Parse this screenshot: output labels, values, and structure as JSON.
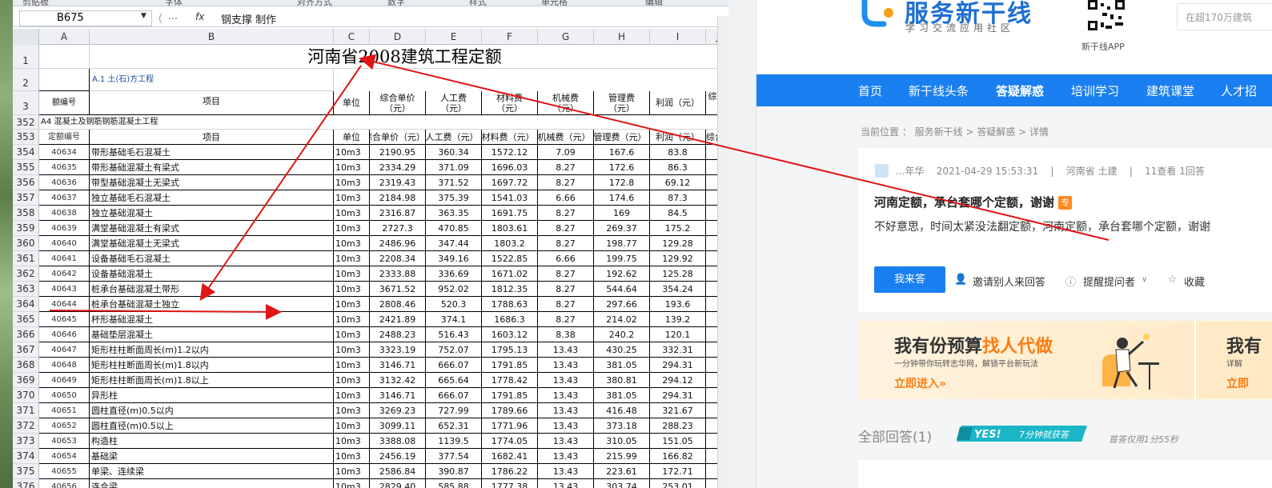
{
  "excel": {
    "ribbon_groups": [
      "剪贴板",
      "字体",
      "对齐方式",
      "数字",
      "样式",
      "单元格",
      "编辑"
    ],
    "name_box": "B675",
    "fx_symbol": "fx",
    "formula_content": "钢支撑 制作",
    "columns": [
      "A",
      "B",
      "C",
      "D",
      "E",
      "F",
      "G",
      "H",
      "I",
      "J"
    ],
    "title": "河南省2008建筑工程定额",
    "section_label": "A.1 土(石)方工程",
    "header_row3": {
      "row_no": "3",
      "code": "额编号",
      "item": "项目",
      "unit": "单位",
      "price": "综合单价\n（元）",
      "labor": "人工费\n（元）",
      "material": "材料费\n（元）",
      "machine": "机械费\n（元）",
      "mgmt": "管理费\n（元）",
      "profit": "利润（元）",
      "extra": "综"
    },
    "row352": {
      "row_no": "352",
      "text": "A4 混凝土及钢筋钢筋混凝土工程"
    },
    "header_row353": {
      "row_no": "353",
      "code": "定额编号",
      "item": "项目",
      "unit": "单位",
      "price": "综合单价（元）",
      "labor": "人工费（元）",
      "material": "材料费（元）",
      "machine": "机械费（元）",
      "mgmt": "管理费（元）",
      "profit": "利润（元）",
      "extra": "综合工"
    },
    "rows": [
      {
        "n": "354",
        "code": "40634",
        "item": "带形基础毛石混凝土",
        "unit": "10m3",
        "price": "2190.95",
        "labor": "360.34",
        "material": "1572.12",
        "machine": "7.09",
        "mgmt": "167.6",
        "profit": "83.8"
      },
      {
        "n": "355",
        "code": "40635",
        "item": "带形基础混凝土有梁式",
        "unit": "10m3",
        "price": "2334.29",
        "labor": "371.09",
        "material": "1696.03",
        "machine": "8.27",
        "mgmt": "172.6",
        "profit": "86.3"
      },
      {
        "n": "356",
        "code": "40636",
        "item": "带型基础混凝土无梁式",
        "unit": "10m3",
        "price": "2319.43",
        "labor": "371.52",
        "material": "1697.72",
        "machine": "8.27",
        "mgmt": "172.8",
        "profit": "69.12"
      },
      {
        "n": "357",
        "code": "40637",
        "item": "独立基础毛石混凝土",
        "unit": "10m3",
        "price": "2184.98",
        "labor": "375.39",
        "material": "1541.03",
        "machine": "6.66",
        "mgmt": "174.6",
        "profit": "87.3"
      },
      {
        "n": "358",
        "code": "40638",
        "item": "独立基础混凝土",
        "unit": "10m3",
        "price": "2316.87",
        "labor": "363.35",
        "material": "1691.75",
        "machine": "8.27",
        "mgmt": "169",
        "profit": "84.5"
      },
      {
        "n": "359",
        "code": "40639",
        "item": "满堂基础混凝土有梁式",
        "unit": "10m3",
        "price": "2727.3",
        "labor": "470.85",
        "material": "1803.61",
        "machine": "8.27",
        "mgmt": "269.37",
        "profit": "175.2"
      },
      {
        "n": "360",
        "code": "40640",
        "item": "满堂基础混凝土无梁式",
        "unit": "10m3",
        "price": "2486.96",
        "labor": "347.44",
        "material": "1803.2",
        "machine": "8.27",
        "mgmt": "198.77",
        "profit": "129.28"
      },
      {
        "n": "361",
        "code": "40641",
        "item": "设备基础毛石混凝土",
        "unit": "10m3",
        "price": "2208.34",
        "labor": "349.16",
        "material": "1522.85",
        "machine": "6.66",
        "mgmt": "199.75",
        "profit": "129.92"
      },
      {
        "n": "362",
        "code": "40642",
        "item": "设备基础混凝土",
        "unit": "10m3",
        "price": "2333.88",
        "labor": "336.69",
        "material": "1671.02",
        "machine": "8.27",
        "mgmt": "192.62",
        "profit": "125.28"
      },
      {
        "n": "363",
        "code": "40643",
        "item": "桩承台基础混凝土带形",
        "unit": "10m3",
        "price": "3671.52",
        "labor": "952.02",
        "material": "1812.35",
        "machine": "8.27",
        "mgmt": "544.64",
        "profit": "354.24"
      },
      {
        "n": "364",
        "code": "40644",
        "item": "桩承台基础混凝土独立",
        "unit": "10m3",
        "price": "2808.46",
        "labor": "520.3",
        "material": "1788.63",
        "machine": "8.27",
        "mgmt": "297.66",
        "profit": "193.6"
      },
      {
        "n": "365",
        "code": "40645",
        "item": "杯形基础混凝土",
        "unit": "10m3",
        "price": "2421.89",
        "labor": "374.1",
        "material": "1686.3",
        "machine": "8.27",
        "mgmt": "214.02",
        "profit": "139.2"
      },
      {
        "n": "366",
        "code": "40646",
        "item": "基础垫层混凝土",
        "unit": "10m3",
        "price": "2488.23",
        "labor": "516.43",
        "material": "1603.12",
        "machine": "8.38",
        "mgmt": "240.2",
        "profit": "120.1"
      },
      {
        "n": "367",
        "code": "40647",
        "item": "矩形柱柱断面周长(m)1.2以内",
        "unit": "10m3",
        "price": "3323.19",
        "labor": "752.07",
        "material": "1795.13",
        "machine": "13.43",
        "mgmt": "430.25",
        "profit": "332.31"
      },
      {
        "n": "368",
        "code": "40648",
        "item": "矩形柱柱断面周长(m)1.8以内",
        "unit": "10m3",
        "price": "3146.71",
        "labor": "666.07",
        "material": "1791.85",
        "machine": "13.43",
        "mgmt": "381.05",
        "profit": "294.31"
      },
      {
        "n": "369",
        "code": "40649",
        "item": "矩形柱柱断面周长(m)1.8以上",
        "unit": "10m3",
        "price": "3132.42",
        "labor": "665.64",
        "material": "1778.42",
        "machine": "13.43",
        "mgmt": "380.81",
        "profit": "294.12"
      },
      {
        "n": "370",
        "code": "40650",
        "item": "异形柱",
        "unit": "10m3",
        "price": "3146.71",
        "labor": "666.07",
        "material": "1791.85",
        "machine": "13.43",
        "mgmt": "381.05",
        "profit": "294.31"
      },
      {
        "n": "371",
        "code": "40651",
        "item": "圆柱直径(m)0.5以内",
        "unit": "10m3",
        "price": "3269.23",
        "labor": "727.99",
        "material": "1789.66",
        "machine": "13.43",
        "mgmt": "416.48",
        "profit": "321.67"
      },
      {
        "n": "372",
        "code": "40652",
        "item": "圆柱直径(m)0.5以上",
        "unit": "10m3",
        "price": "3099.11",
        "labor": "652.31",
        "material": "1771.96",
        "machine": "13.43",
        "mgmt": "373.18",
        "profit": "288.23"
      },
      {
        "n": "373",
        "code": "40653",
        "item": "构造柱",
        "unit": "10m3",
        "price": "3388.08",
        "labor": "1139.5",
        "material": "1774.05",
        "machine": "13.43",
        "mgmt": "310.05",
        "profit": "151.05"
      },
      {
        "n": "374",
        "code": "40654",
        "item": "基础梁",
        "unit": "10m3",
        "price": "2456.19",
        "labor": "377.54",
        "material": "1682.41",
        "machine": "13.43",
        "mgmt": "215.99",
        "profit": "166.82"
      },
      {
        "n": "375",
        "code": "40655",
        "item": "单梁、连续梁",
        "unit": "10m3",
        "price": "2586.84",
        "labor": "390.87",
        "material": "1786.22",
        "machine": "13.43",
        "mgmt": "223.61",
        "profit": "172.71"
      },
      {
        "n": "376",
        "code": "40656",
        "item": "连合梁",
        "unit": "10m3",
        "price": "2829.40",
        "labor": "585.88",
        "material": "1777.38",
        "machine": "13.43",
        "mgmt": "303.74",
        "profit": "253.01"
      }
    ],
    "row_labels_top": [
      "1",
      "2"
    ]
  },
  "site": {
    "logo_text": "服务新干线",
    "logo_sub": "学习交流应用社区",
    "qr_label": "新干线APP",
    "search_placeholder": "在超170万建筑",
    "nav": [
      "首页",
      "新干线头条",
      "答疑解惑",
      "培训学习",
      "建筑课堂",
      "人才招"
    ],
    "nav_active_index": 2,
    "breadcrumb": "当前位置 ： 服务新干线 > 答疑解惑 > 详情",
    "question": {
      "meta_user": "...年华",
      "meta_time": "2021-04-29 15:53:31",
      "meta_location": "河南省  土建",
      "meta_stats": "11查看  1回答",
      "meta_sep": "|",
      "title": "河南定额，承台套哪个定额，谢谢",
      "tag": "专",
      "body": "不好意思，时间太紧没法翻定额，河南定额，承台套哪个定额，谢谢",
      "answer_btn": "我来答",
      "invite": "邀请别人来回答",
      "remind": "提醒提问者",
      "collect": "收藏"
    },
    "banner": {
      "title_a": "我有份预算",
      "title_b": "找人代做",
      "sub": "一分钟带你玩转志华网，解锁平台新玩法",
      "cta": "立即进入»",
      "right_title": "我有",
      "right_sub": "详解",
      "right_cta": "立即"
    },
    "all_answers": "全部回答(1)",
    "yes_badge_a": "YES!",
    "yes_badge_b": "7分钟就获答",
    "first_answer": "首答仅用1分55秒"
  },
  "colors": {
    "nav_blue": "#1a7ff0",
    "arrow_red": "#e01515",
    "accent_orange": "#ff7b12"
  }
}
